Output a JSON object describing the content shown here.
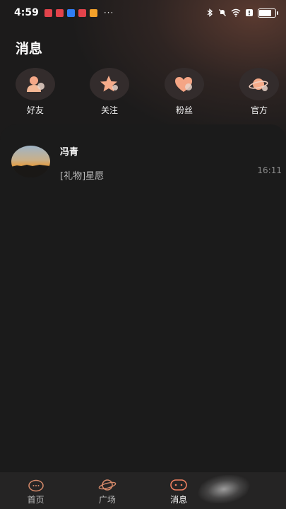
{
  "status_bar": {
    "time": "4:59",
    "more": "···",
    "notif_colors": [
      "#e2434b",
      "#e2434b",
      "#2f7ef6",
      "#e2434b",
      "#f4a12a"
    ],
    "icons": [
      "bluetooth-icon",
      "mute-icon",
      "wifi-icon",
      "alert-icon",
      "battery-icon"
    ]
  },
  "header": {
    "title": "消息"
  },
  "categories": [
    {
      "label": "好友",
      "icon": "friend-icon"
    },
    {
      "label": "关注",
      "icon": "star-icon"
    },
    {
      "label": "粉丝",
      "icon": "heart-icon"
    },
    {
      "label": "官方",
      "icon": "planet-icon"
    }
  ],
  "messages": [
    {
      "name": "冯青",
      "preview": "[礼物]星愿",
      "time": "16:11"
    }
  ],
  "bottom_nav": [
    {
      "label": "首页",
      "icon": "home-face-icon",
      "active": false
    },
    {
      "label": "广场",
      "icon": "planet-icon",
      "active": false
    },
    {
      "label": "消息",
      "icon": "message-icon",
      "active": true
    }
  ],
  "colors": {
    "accent": "#f2a07a",
    "background": "#1a1a1a",
    "nav_bg": "#252424"
  }
}
